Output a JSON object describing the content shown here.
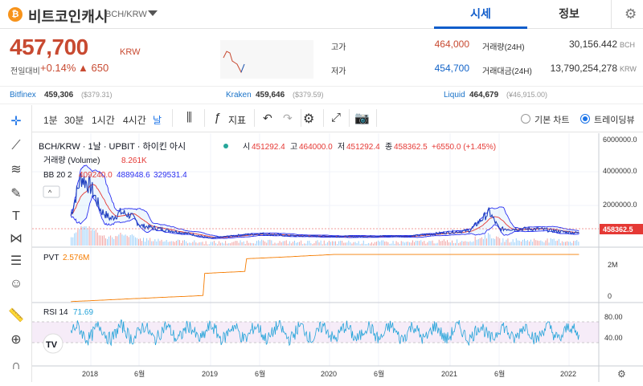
{
  "header": {
    "coin_icon": "bitcoin-cash-icon",
    "coin_icon_glyph": "₿",
    "coin_name": "비트코인캐시",
    "pair": "BCH/KRW",
    "tabs": [
      {
        "label": "시세",
        "active": true
      },
      {
        "label": "정보",
        "active": false
      }
    ]
  },
  "price": {
    "current": "457,700",
    "currency": "KRW",
    "change_label": "전일대비",
    "change_pct": "+0.14%",
    "change_amount": "▲ 650",
    "up_color": "#c84a31",
    "down_color": "#1263c8"
  },
  "stats": {
    "high_label": "고가",
    "high": "464,000",
    "low_label": "저가",
    "low": "454,700",
    "volume_label": "거래량(24H)",
    "volume": "30,156.442",
    "volume_unit": "BCH",
    "amount_label": "거래대금(24H)",
    "amount": "13,790,254,278",
    "amount_unit": "KRW"
  },
  "exchanges": [
    {
      "name": "Bitfinex",
      "value": "459,306",
      "usd": "($379.31)"
    },
    {
      "name": "Kraken",
      "value": "459,646",
      "usd": "($379.59)"
    },
    {
      "name": "Liquid",
      "value": "464,679",
      "usd": "(¥46,915.00)"
    }
  ],
  "toolbar": {
    "intervals": [
      "1분",
      "30분",
      "1시간",
      "4시간",
      "날"
    ],
    "active_interval": "날",
    "indicators_label": "지표",
    "chart_modes": [
      {
        "label": "기본 차트",
        "selected": false
      },
      {
        "label": "트레이딩뷰",
        "selected": true
      }
    ]
  },
  "chart": {
    "legend_symbol": "BCH/KRW · 1날 · UPBIT · 하이킨 아시",
    "ohlc_open_label": "시",
    "ohlc_open": "451292.4",
    "ohlc_high_label": "고",
    "ohlc_high": "464000.0",
    "ohlc_low_label": "저",
    "ohlc_low": "451292.4",
    "ohlc_close_label": "종",
    "ohlc_close": "458362.5",
    "ohlc_change": "+6550.0 (+1.45%)",
    "volume_label": "거래량 (Volume)",
    "volume_value": "8.261K",
    "bb_label": "BB 20 2",
    "bb_mid": "409240.0",
    "bb_upper": "488948.6",
    "bb_lower": "329531.4",
    "last_price_tag": "458362.5",
    "pvt_label": "PVT",
    "pvt_value": "2.576M",
    "rsi_label": "RSI 14",
    "rsi_value": "71.69",
    "logo_text": "TV",
    "price_axis_ticks": [
      "6000000.0",
      "4000000.0",
      "2000000.0"
    ],
    "pvt_axis_ticks": [
      "2M",
      "0"
    ],
    "rsi_axis_ticks": [
      "80.00",
      "40.00"
    ],
    "time_axis_ticks": [
      "2018",
      "6월",
      "2019",
      "6월",
      "2020",
      "6월",
      "2021",
      "6월",
      "2022"
    ]
  },
  "chart_data": {
    "type": "line",
    "title": "BCH/KRW · 1날 · UPBIT · 하이킨 아시",
    "x": [
      "2017-11",
      "2017-12",
      "2018-01",
      "2018-02",
      "2018-03",
      "2018-04",
      "2018-05",
      "2018-06",
      "2018-08",
      "2018-11",
      "2019-01",
      "2019-04",
      "2019-06",
      "2019-09",
      "2020-01",
      "2020-03",
      "2020-06",
      "2020-09",
      "2021-01",
      "2021-03",
      "2021-05",
      "2021-06",
      "2021-08",
      "2021-10",
      "2021-12",
      "2022-02"
    ],
    "series": [
      {
        "name": "BCH/KRW",
        "values": [
          1500000,
          3800000,
          3200000,
          1800000,
          1300000,
          1700000,
          1500000,
          900000,
          700000,
          400000,
          150000,
          330000,
          420000,
          300000,
          260000,
          250000,
          270000,
          270000,
          500000,
          600000,
          1700000,
          700000,
          700000,
          700000,
          550000,
          458362
        ]
      }
    ],
    "ylim": [
      0,
      6500000
    ],
    "rsi_levels": [
      70,
      30
    ],
    "legend": "top-left"
  }
}
